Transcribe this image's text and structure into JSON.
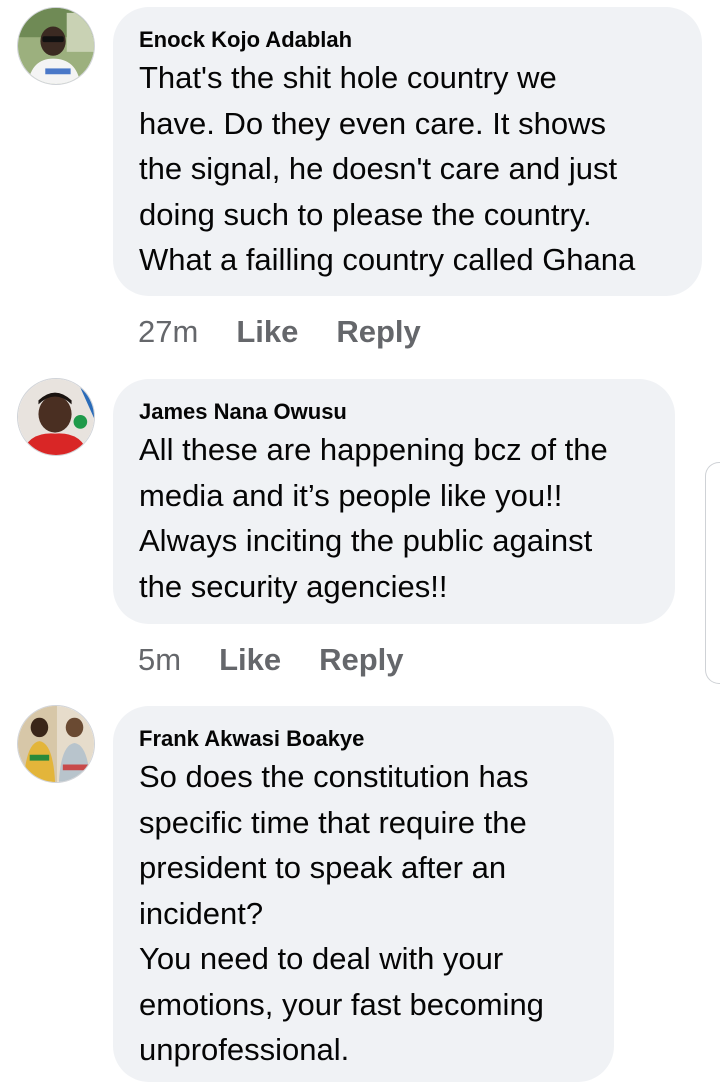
{
  "comments": [
    {
      "author": "Enock Kojo Adablah",
      "lines": [
        "That's the shit hole country we",
        "have.  Do they even care.  It shows",
        "the signal, he doesn't care and just",
        "doing such to please the country.",
        "What a failling country called Ghana"
      ],
      "time": "27m",
      "like_label": "Like",
      "reply_label": "Reply"
    },
    {
      "author": "James Nana Owusu",
      "lines": [
        "All these are happening bcz of the",
        "media and it’s people like you!!",
        "Always inciting the public against",
        "the security agencies!!"
      ],
      "time": "5m",
      "like_label": "Like",
      "reply_label": "Reply"
    },
    {
      "author": "Frank Akwasi Boakye",
      "lines": [
        "So does the constitution has",
        "specific time that require the",
        "president to speak after an",
        "incident?",
        "You need to deal with your",
        "emotions, your fast becoming",
        "unprofessional."
      ]
    }
  ],
  "colors": {
    "bubble_bg": "#f0f2f5",
    "author_text": "#050505",
    "body_text": "#050505",
    "action_text": "#65676b"
  }
}
